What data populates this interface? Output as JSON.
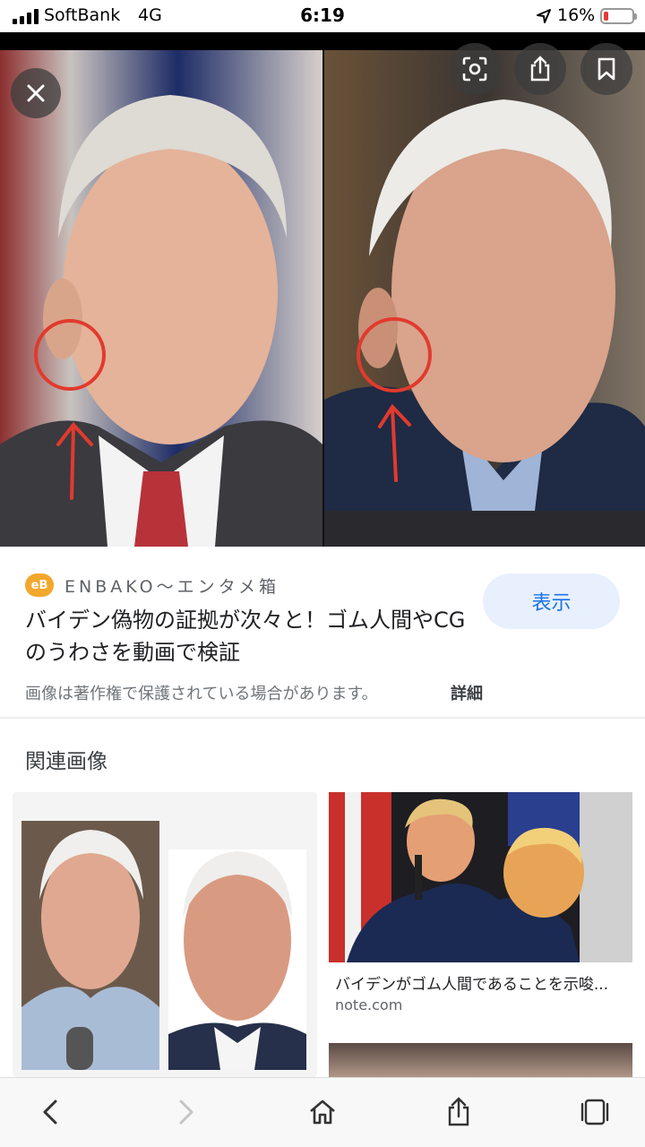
{
  "status_bar": {
    "carrier": "SoftBank",
    "network": "4G",
    "time": "6:19",
    "battery_percent": "16%",
    "battery_level": 0.16,
    "battery_color": "#e53935"
  },
  "viewer": {
    "close_icon": "close-icon",
    "lens_icon": "lens-icon",
    "share_icon": "share-icon",
    "bookmark_icon": "bookmark-icon"
  },
  "source": {
    "logo_text": "eB",
    "site_name": "ENBAKO〜エンタメ箱",
    "title": "バイデン偽物の証拠が次々と！ゴム人間やCGのうわさを動画で検証",
    "view_label": "表示",
    "copyright_notice": "画像は著作権で保護されている場合があります。",
    "details_label": "詳細",
    "accent_color": "#1a73e8"
  },
  "related": {
    "heading": "関連画像",
    "items": [
      {},
      {
        "caption": "バイデンがゴム人間であることを示唆...",
        "domain": "note.com"
      }
    ]
  },
  "toolbar": {
    "back_icon": "chevron-left-icon",
    "forward_icon": "chevron-right-icon",
    "home_icon": "home-icon",
    "share_icon": "share-icon",
    "tabs_icon": "tabs-icon"
  }
}
